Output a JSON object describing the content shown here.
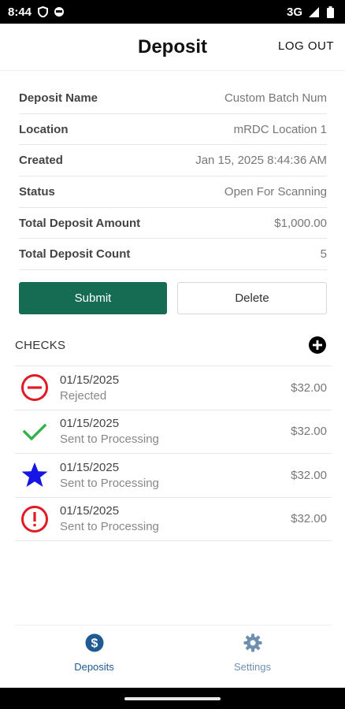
{
  "status_bar": {
    "time": "8:44",
    "network": "3G",
    "icons": [
      "shield-icon",
      "face-icon",
      "signal-icon",
      "battery-icon"
    ]
  },
  "header": {
    "title": "Deposit",
    "logout_label": "LOG OUT"
  },
  "details": [
    {
      "label": "Deposit Name",
      "value": "Custom Batch Num"
    },
    {
      "label": "Location",
      "value": "mRDC Location 1"
    },
    {
      "label": "Created",
      "value": "Jan 15, 2025 8:44:36 AM"
    },
    {
      "label": "Status",
      "value": "Open For Scanning"
    },
    {
      "label": "Total Deposit Amount",
      "value": "$1,000.00"
    },
    {
      "label": "Total Deposit Count",
      "value": "5"
    }
  ],
  "actions": {
    "submit_label": "Submit",
    "delete_label": "Delete"
  },
  "checks": {
    "title": "CHECKS",
    "items": [
      {
        "date": "01/15/2025",
        "status": "Rejected",
        "amount": "$32.00",
        "icon": "minus-circle-icon"
      },
      {
        "date": "01/15/2025",
        "status": "Sent to Processing",
        "amount": "$32.00",
        "icon": "checkmark-icon"
      },
      {
        "date": "01/15/2025",
        "status": "Sent to Processing",
        "amount": "$32.00",
        "icon": "star-icon"
      },
      {
        "date": "01/15/2025",
        "status": "Sent to Processing",
        "amount": "$32.00",
        "icon": "exclamation-circle-icon"
      }
    ]
  },
  "bottom_nav": {
    "deposits_label": "Deposits",
    "settings_label": "Settings"
  },
  "colors": {
    "submit_green": "#166c52",
    "reject_red": "#e01b24",
    "check_green": "#2fb34a",
    "star_blue": "#1515e6",
    "nav_active": "#1f5a93",
    "nav_inactive": "#6f8fb1"
  }
}
